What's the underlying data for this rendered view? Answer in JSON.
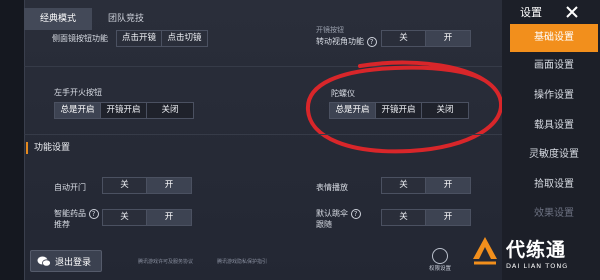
{
  "tabs": [
    {
      "label": "经典模式",
      "active": true
    },
    {
      "label": "团队竞技",
      "active": false
    }
  ],
  "top_row": {
    "left_label": "侧面镜按钮功能",
    "left_options": [
      "点击开镜",
      "点击切镜"
    ],
    "right_label_line1": "开镜按钮",
    "right_label_line2": "转动视角功能",
    "right_options": [
      "关",
      "开"
    ]
  },
  "fire_button": {
    "label": "左手开火按钮",
    "options": [
      "总是开启",
      "开镜开启",
      "关闭"
    ]
  },
  "gyroscope": {
    "label": "陀螺仪",
    "options": [
      "总是开启",
      "开镜开启",
      "关闭"
    ]
  },
  "function_section": {
    "title": "功能设置"
  },
  "auto_door": {
    "label": "自动开门",
    "options": [
      "关",
      "开"
    ]
  },
  "emote": {
    "label": "表情播放",
    "options": [
      "关",
      "开"
    ]
  },
  "smart_medicine": {
    "label_line1": "智能药品",
    "label_line2": "推荐",
    "options": [
      "关",
      "开"
    ]
  },
  "silent_follow": {
    "label_line1": "默认跳伞",
    "label_line2": "跟随",
    "options": [
      "关",
      "开"
    ]
  },
  "footer_links": [
    "腾讯游戏许可及服务协议",
    "腾讯游戏隐私保护指引"
  ],
  "logout": {
    "label": "退出登录",
    "icon": "wechat-icon"
  },
  "permission": {
    "label": "权限设置"
  },
  "sidebar": {
    "title": "设置",
    "items": [
      {
        "label": "基础设置",
        "active": true
      },
      {
        "label": "画面设置",
        "active": false
      },
      {
        "label": "操作设置",
        "active": false
      },
      {
        "label": "载具设置",
        "active": false
      },
      {
        "label": "灵敏度设置",
        "active": false
      },
      {
        "label": "拾取设置",
        "active": false
      },
      {
        "label": "效果设置",
        "active": false
      }
    ]
  },
  "watermark": {
    "cn": "代练通",
    "en": "DAI LIAN TONG"
  },
  "colors": {
    "accent": "#f28f1c",
    "highlight_circle": "#d8262a"
  }
}
